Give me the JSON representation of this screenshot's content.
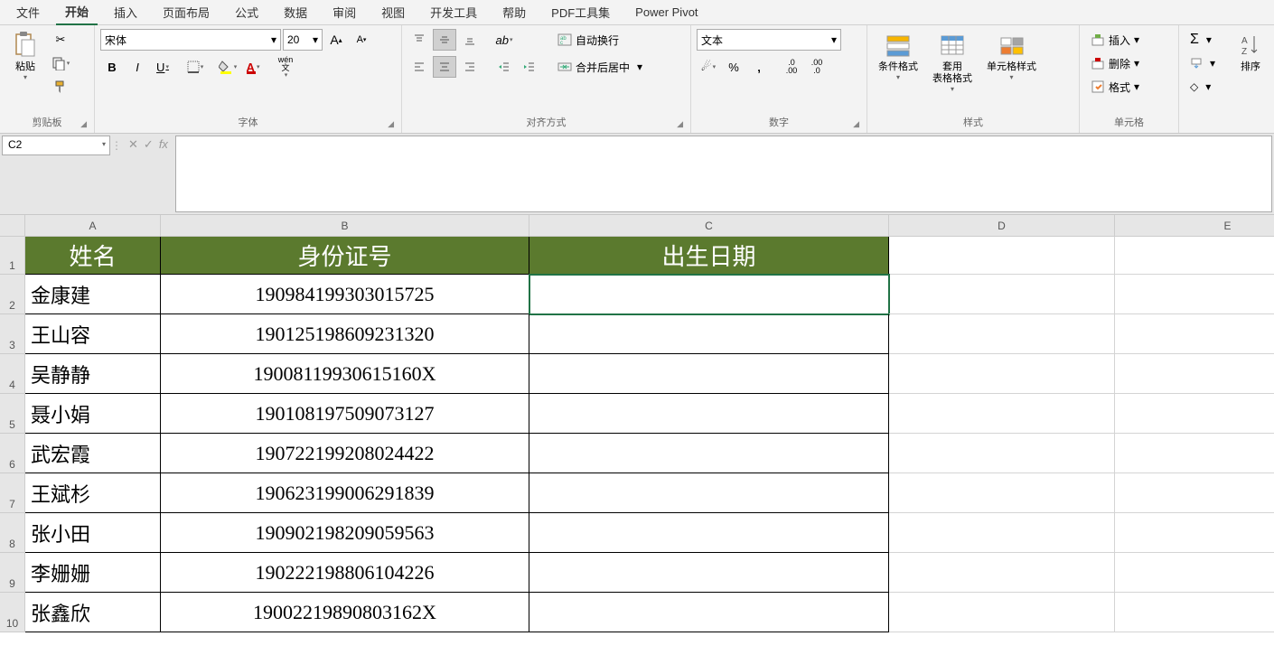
{
  "menu": {
    "tabs": [
      "文件",
      "开始",
      "插入",
      "页面布局",
      "公式",
      "数据",
      "审阅",
      "视图",
      "开发工具",
      "帮助",
      "PDF工具集",
      "Power Pivot"
    ],
    "active_index": 1
  },
  "ribbon": {
    "clipboard": {
      "title": "剪贴板",
      "paste": "粘贴"
    },
    "font": {
      "title": "字体",
      "name": "宋体",
      "size": "20",
      "bold": "B",
      "italic": "I",
      "underline": "U",
      "pinyin": "wén"
    },
    "align": {
      "title": "对齐方式",
      "wrap": "自动换行",
      "merge": "合并后居中"
    },
    "number": {
      "title": "数字",
      "format": "文本"
    },
    "styles": {
      "title": "样式",
      "cond": "条件格式",
      "table": "套用\n表格格式",
      "cell": "单元格样式"
    },
    "cells": {
      "title": "单元格",
      "insert": "插入",
      "delete": "删除",
      "format": "格式"
    },
    "editing": {
      "sort": "排序"
    }
  },
  "namebox": "C2",
  "columns": [
    "A",
    "B",
    "C",
    "D",
    "E"
  ],
  "row_numbers": [
    "1",
    "2",
    "3",
    "4",
    "5",
    "6",
    "7",
    "8",
    "9",
    "10"
  ],
  "headers": {
    "A": "姓名",
    "B": "身份证号",
    "C": "出生日期"
  },
  "rows": [
    {
      "A": "金康建",
      "B": "190984199303015725",
      "C": ""
    },
    {
      "A": "王山容",
      "B": "190125198609231320",
      "C": ""
    },
    {
      "A": "吴静静",
      "B": "19008119930615160X",
      "C": ""
    },
    {
      "A": "聂小娟",
      "B": "190108197509073127",
      "C": ""
    },
    {
      "A": "武宏霞",
      "B": "190722199208024422",
      "C": ""
    },
    {
      "A": "王斌杉",
      "B": "190623199006291839",
      "C": ""
    },
    {
      "A": "张小田",
      "B": "190902198209059563",
      "C": ""
    },
    {
      "A": "李姗姗",
      "B": "190222198806104226",
      "C": ""
    },
    {
      "A": "张鑫欣",
      "B": "19002219890803162X",
      "C": ""
    }
  ],
  "selected_cell": "C2"
}
